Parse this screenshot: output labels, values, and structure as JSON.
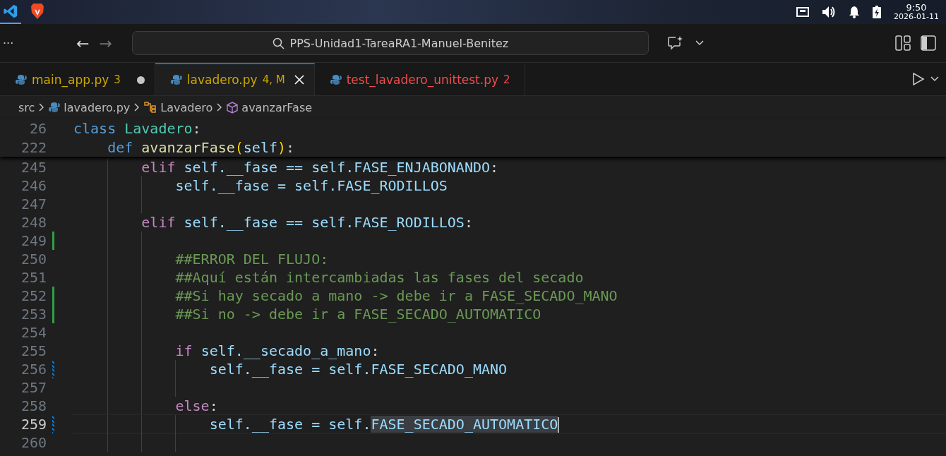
{
  "taskbar": {
    "apps": [
      {
        "kind": "vscode",
        "selected": true
      },
      {
        "kind": "brave",
        "selected": false
      }
    ],
    "time": "9:50",
    "date": "2026-01-11"
  },
  "title_bar": {
    "menu": "···",
    "back": "←",
    "forward": "→",
    "search": "PPS-Unidad1-TareaRA1-Manuel-Benitez"
  },
  "tabs": [
    {
      "label": "main_app.py",
      "badge": "3",
      "kind": "warning",
      "selected": false,
      "dirty": true
    },
    {
      "label": "lavadero.py",
      "badge": "4, M",
      "kind": "warning",
      "selected": true,
      "dirty": false
    },
    {
      "label": "test_lavadero_unittest.py",
      "badge": "2",
      "kind": "error",
      "selected": false,
      "dirty": false
    }
  ],
  "breadcrumb": [
    {
      "kind": "folder",
      "label": "src"
    },
    {
      "kind": "python",
      "label": "lavadero.py"
    },
    {
      "kind": "class",
      "label": "Lavadero"
    },
    {
      "kind": "method",
      "label": "avanzarFase"
    }
  ],
  "sticky_lines": [
    {
      "number": "26",
      "tokens": [
        {
          "text": "class ",
          "kind": "keyword"
        },
        {
          "text": "Lavadero",
          "kind": "class"
        },
        {
          "text": ":",
          "kind": "punct"
        }
      ]
    },
    {
      "number": "222",
      "tokens": [
        {
          "text": "    def ",
          "kind": "keyword"
        },
        {
          "text": "avanzarFase",
          "kind": "function"
        },
        {
          "text": "(",
          "kind": "bracket"
        },
        {
          "text": "self",
          "kind": "variable"
        },
        {
          "text": ")",
          "kind": "bracket"
        },
        {
          "text": ":",
          "kind": "punct"
        }
      ]
    }
  ],
  "lines": [
    {
      "number": "245",
      "added": false,
      "modified": false,
      "current": false,
      "tokens": [
        {
          "text": "        elif ",
          "kind": "control"
        },
        {
          "text": "self.__fase == self.FASE_ENJABONANDO",
          "kind": "variable"
        },
        {
          "text": ":",
          "kind": "punct"
        }
      ]
    },
    {
      "number": "246",
      "added": false,
      "modified": false,
      "current": false,
      "tokens": [
        {
          "text": "            self.__fase = self.FASE_RODILLOS",
          "kind": "variable"
        }
      ]
    },
    {
      "number": "247",
      "added": false,
      "modified": false,
      "current": false
    },
    {
      "number": "248",
      "added": false,
      "modified": false,
      "current": false,
      "tokens": [
        {
          "text": "        elif ",
          "kind": "control"
        },
        {
          "text": "self.__fase == self.FASE_RODILLOS",
          "kind": "variable"
        },
        {
          "text": ":",
          "kind": "punct"
        }
      ]
    },
    {
      "number": "249",
      "added": true,
      "modified": false,
      "current": false
    },
    {
      "number": "250",
      "added": false,
      "modified": false,
      "current": false,
      "tokens": [
        {
          "text": "            ##ERROR DEL FLUJO:",
          "kind": "comment"
        }
      ]
    },
    {
      "number": "251",
      "added": false,
      "modified": false,
      "current": false,
      "tokens": [
        {
          "text": "            ##Aquí están intercambiadas las fases del secado",
          "kind": "comment"
        }
      ]
    },
    {
      "number": "252",
      "added": true,
      "modified": false,
      "current": false,
      "tokens": [
        {
          "text": "            ##Si hay secado a mano -> debe ir a FASE_SECADO_MANO",
          "kind": "comment"
        }
      ]
    },
    {
      "number": "253",
      "added": true,
      "modified": false,
      "current": false,
      "tokens": [
        {
          "text": "            ##Si no -> debe ir a FASE_SECADO_AUTOMATICO",
          "kind": "comment"
        }
      ]
    },
    {
      "number": "254",
      "added": false,
      "modified": false,
      "current": false
    },
    {
      "number": "255",
      "added": false,
      "modified": false,
      "current": false,
      "tokens": [
        {
          "text": "            if ",
          "kind": "control"
        },
        {
          "text": "self.__secado_a_mano",
          "kind": "variable"
        },
        {
          "text": ":",
          "kind": "punct"
        }
      ]
    },
    {
      "number": "256",
      "added": false,
      "modified": true,
      "current": false,
      "tokens": [
        {
          "text": "                self.__fase = self.FASE_SECADO_MANO",
          "kind": "variable"
        }
      ]
    },
    {
      "number": "257",
      "added": false,
      "modified": false,
      "current": false
    },
    {
      "number": "258",
      "added": false,
      "modified": false,
      "current": false,
      "tokens": [
        {
          "text": "            else",
          "kind": "control"
        },
        {
          "text": ":",
          "kind": "punct"
        }
      ]
    },
    {
      "number": "259",
      "added": false,
      "modified": true,
      "current": true,
      "tokens": [
        {
          "text": "                self.__fase = self.",
          "kind": "variable"
        },
        {
          "text": "FASE_SECADO_AUTOMATICO",
          "kind": "variable",
          "highlighted": true
        }
      ]
    },
    {
      "number": "260",
      "added": false,
      "modified": false,
      "current": false
    }
  ]
}
